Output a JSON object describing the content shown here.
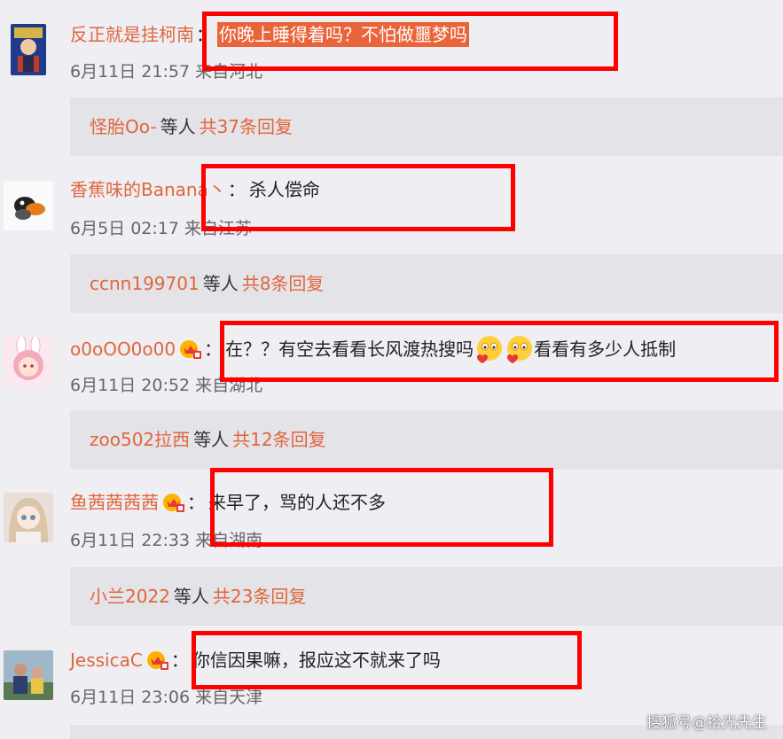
{
  "comments": [
    {
      "username": "反正就是挂柯南",
      "colon": "：",
      "text": "你晚上睡得着吗？不怕做噩梦吗",
      "meta": "6月11日 21:57 来自河北",
      "avatar_icon": "detective-avatar",
      "vip": false
    },
    {
      "username": "香蕉味的Banana丶",
      "colon": "：",
      "text": "杀人偿命",
      "meta": "6月5日 02:17 来自江苏",
      "avatar_icon": "penguin-avatar",
      "vip": false
    },
    {
      "username": "o0oOO0o00",
      "colon": "：",
      "text_before": "在？？有空去看看长风渡热搜吗",
      "text_after": "看看有多少人抵制",
      "meta": "6月11日 20:52 来自湖北",
      "avatar_icon": "bunny-girl-avatar",
      "vip": true
    },
    {
      "username": "鱼茜茜茜茜",
      "colon": "：",
      "text": "来早了，骂的人还不多",
      "meta": "6月11日 22:33 来自湖南",
      "avatar_icon": "doll-avatar",
      "vip": true
    },
    {
      "username": "JessicaC",
      "colon": "：",
      "text": "你信因果嘛，报应这不就来了吗",
      "meta": "6月11日 23:06 来自天津",
      "avatar_icon": "photo-avatar",
      "vip": true
    }
  ],
  "replies": [
    {
      "user": "怪胎Oo-",
      "mid": "等人",
      "count": "共37条回复"
    },
    {
      "user": "ccnn199701",
      "mid": "等人",
      "count": "共8条回复"
    },
    {
      "user": "zoo502拉西",
      "mid": "等人",
      "count": "共12条回复"
    },
    {
      "user": "小兰2022",
      "mid": "等人",
      "count": "共23条回复"
    }
  ],
  "watermark": "搜狐号@拾光先生",
  "colors": {
    "username": "#e0663c",
    "highlight": "#e9643a",
    "annotation": "#ff0000",
    "background": "#efeef3"
  }
}
